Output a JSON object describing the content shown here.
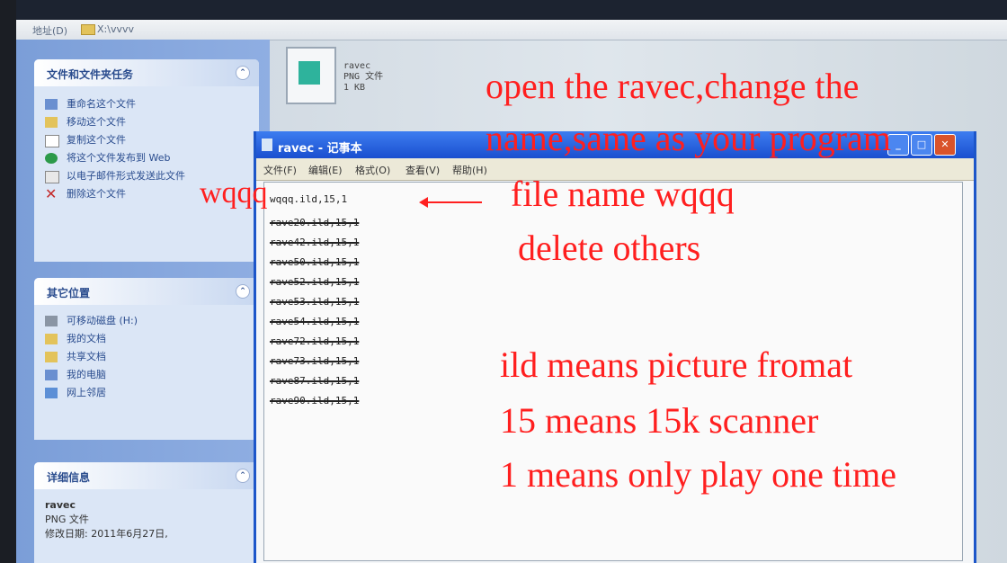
{
  "explorer": {
    "address_label": "地址(D)",
    "address_path": "X:\\vvvv",
    "tasks_title": "文件和文件夹任务",
    "tasks": [
      "重命名这个文件",
      "移动这个文件",
      "复制这个文件",
      "将这个文件发布到 Web",
      "以电子邮件形式发送此文件",
      "删除这个文件"
    ],
    "places_title": "其它位置",
    "places": [
      "可移动磁盘 (H:)",
      "我的文档",
      "共享文档",
      "我的电脑",
      "网上邻居"
    ],
    "details_title": "详细信息",
    "details": [
      "ravec",
      "PNG 文件",
      "修改日期: 2011年6月27日,"
    ],
    "file": {
      "name": "ravec",
      "type": "PNG 文件",
      "size": "1 KB"
    }
  },
  "notepad": {
    "title": "ravec - 记事本",
    "menu": [
      "文件(F)",
      "编辑(E)",
      "格式(O)",
      "查看(V)",
      "帮助(H)"
    ],
    "lines": [
      {
        "text": "wqqq.ild,15,1",
        "strike": false
      },
      {
        "text": "rave20.ild,15,1",
        "strike": true
      },
      {
        "text": "rave42.ild,15,1",
        "strike": true
      },
      {
        "text": "rave50.ild,15,1",
        "strike": true
      },
      {
        "text": "rave52.ild,15,1",
        "strike": true
      },
      {
        "text": "rave53.ild,15,1",
        "strike": true
      },
      {
        "text": "rave54.ild,15,1",
        "strike": true
      },
      {
        "text": "rave72.ild,15,1",
        "strike": true
      },
      {
        "text": "rave73.ild,15,1",
        "strike": true
      },
      {
        "text": "rave87.ild,15,1",
        "strike": true
      },
      {
        "text": "rave90.ild,15,1",
        "strike": true
      }
    ]
  },
  "annotations": {
    "line1": "open the ravec,change the",
    "line2": "name,same as your program",
    "line3": "file name wqqq",
    "line4": "delete others",
    "left_label": "wqqq",
    "note1": "ild means picture fromat",
    "note2": "15 means 15k scanner",
    "note3": "1 means only play one time"
  },
  "colors": {
    "annotation": "#ff1f1f",
    "titlebar": "#1d56c9",
    "task_pane": "#8faee2"
  }
}
